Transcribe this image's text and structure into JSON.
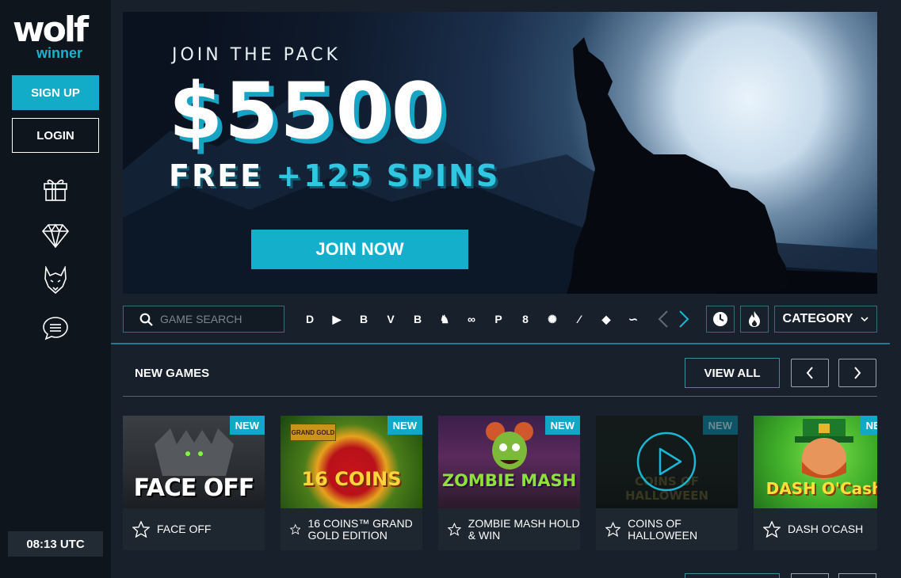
{
  "brand": {
    "logo_top": "wolf",
    "logo_bottom": "winner",
    "accent_color": "#12acc9"
  },
  "sidebar": {
    "signup_label": "SIGN UP",
    "login_label": "LOGIN",
    "icons": [
      "gift-icon",
      "diamond-icon",
      "wolf-head-icon",
      "chat-icon"
    ],
    "clock": "08:13 UTC"
  },
  "banner": {
    "kicker": "JOIN THE PACK",
    "amount": "$5500",
    "free_label": "FREE",
    "spins_label": "+125 SPINS",
    "cta": "JOIN NOW"
  },
  "filters": {
    "search_placeholder": "GAME SEARCH",
    "providers": [
      "D",
      "▶",
      "B",
      "V",
      "B",
      "♞",
      "∞",
      "P",
      "8",
      "✺",
      "⁄",
      "◆",
      "∽"
    ],
    "category_label": "CATEGORY"
  },
  "new_games": {
    "title": "NEW GAMES",
    "view_all": "VIEW ALL",
    "items": [
      {
        "title": "FACE OFF",
        "badge": "NEW",
        "art": "FACE OFF"
      },
      {
        "title": "16 COINS™ GRAND GOLD EDITION",
        "badge": "NEW",
        "art": "16 COINS"
      },
      {
        "title": "ZOMBIE MASH HOLD & WIN",
        "badge": "NEW",
        "art": "ZOMBIE MASH"
      },
      {
        "title": "COINS OF HALLOWEEN",
        "badge": "NEW",
        "art": "COINS OF HALLOWEEN"
      },
      {
        "title": "DASH O'CASH",
        "badge": "NEW",
        "art": "DASH O'Cash"
      }
    ]
  }
}
